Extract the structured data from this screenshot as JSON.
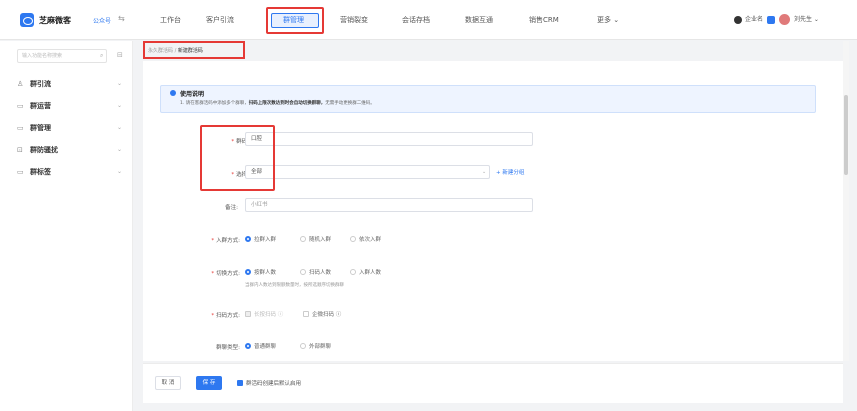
{
  "header": {
    "brand": "芝麻微客",
    "gzh": "公众号",
    "nav": [
      "工作台",
      "客户引流",
      "群管理",
      "营销裂变",
      "会话存档",
      "数据互通",
      "销售CRM",
      "更多"
    ],
    "active_nav": "群管理",
    "user": "企业名",
    "account": "刘先生"
  },
  "sidebar": {
    "search_placeholder": "输入功能名称搜索",
    "items": [
      {
        "label": "群引流"
      },
      {
        "label": "群运营"
      },
      {
        "label": "群管理"
      },
      {
        "label": "群防骚扰"
      },
      {
        "label": "群标签"
      }
    ]
  },
  "breadcrumb": {
    "parent": "永久群活码",
    "current": "新建群活码"
  },
  "tip": {
    "title": "使用说明",
    "text_pre": "1. 请在客群活码中添加多个群聊，",
    "text_bold": "扫码上限次数达到时会自动切换群聊，",
    "text_post": "无需手动更换群二维码。"
  },
  "form": {
    "name_label": "群码名称:",
    "name_value": "口腔",
    "group_label": "选择分组:",
    "group_value": "全部",
    "new_group": "+ 新建分组",
    "remark_label": "备注:",
    "remark_value": "小红书",
    "join_label": "入群方式:",
    "join_options": [
      "拉群入群",
      "随机入群",
      "依次入群"
    ],
    "switch_label": "切换方式:",
    "switch_options": [
      "按群人数",
      "扫码人数",
      "入群人数"
    ],
    "switch_hint": "当群内人数达到限额数量时，按所选顺序切换群聊",
    "scan_label": "扫码方式:",
    "scan_options": [
      "长按扫码 ⓘ",
      "企微扫码 ⓘ"
    ],
    "type_label": "群聊类型:",
    "type_options": [
      "普通群聊",
      "外部群聊"
    ]
  },
  "footer": {
    "cancel": "取 消",
    "save": "保 存",
    "default_label": "群活码创建后默认启用"
  }
}
